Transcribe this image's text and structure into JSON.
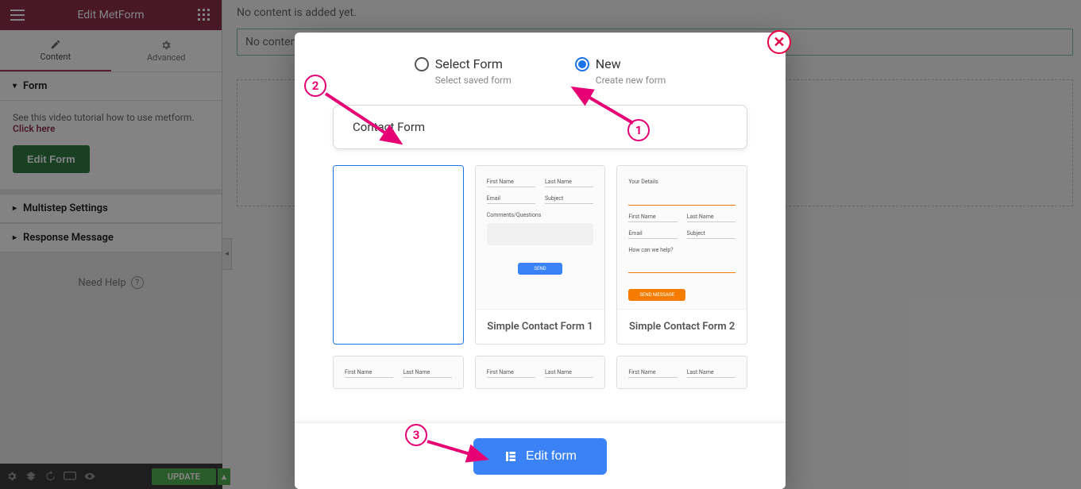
{
  "panel": {
    "title": "Edit MetForm",
    "tabs": {
      "content": "Content",
      "advanced": "Advanced"
    },
    "form_section": {
      "title": "Form",
      "help_text": "See this video tutorial how to use metform. ",
      "help_link": "Click here",
      "edit_button": "Edit Form"
    },
    "multistep_title": "Multistep Settings",
    "response_title": "Response Message",
    "need_help": "Need Help",
    "update_btn": "UPDATE"
  },
  "canvas": {
    "no_content_top": "No content is added yet.",
    "no_content_bar": "No content"
  },
  "modal": {
    "select_form_label": "Select Form",
    "select_form_sub": "Select saved form",
    "new_label": "New",
    "new_sub": "Create new form",
    "form_name_value": "Contact Form",
    "templates": {
      "t1": {
        "label": ""
      },
      "t2": {
        "label": "Simple Contact Form 1",
        "f1": "First Name",
        "f2": "Last Name",
        "f3": "Email",
        "f4": "Subject",
        "f5": "Comments/Questions",
        "btn": "SEND"
      },
      "t3": {
        "label": "Simple Contact Form 2",
        "top": "Your Details",
        "f1": "First Name",
        "f2": "Last Name",
        "f3": "Email",
        "f4": "Subject",
        "f5": "How can we help?",
        "btn": "SEND MESSAGE"
      },
      "row2": {
        "f1": "First Name",
        "f2": "Last Name"
      }
    },
    "edit_form_btn": "Edit form"
  },
  "annotations": {
    "b1": "1",
    "b2": "2",
    "b3": "3"
  }
}
